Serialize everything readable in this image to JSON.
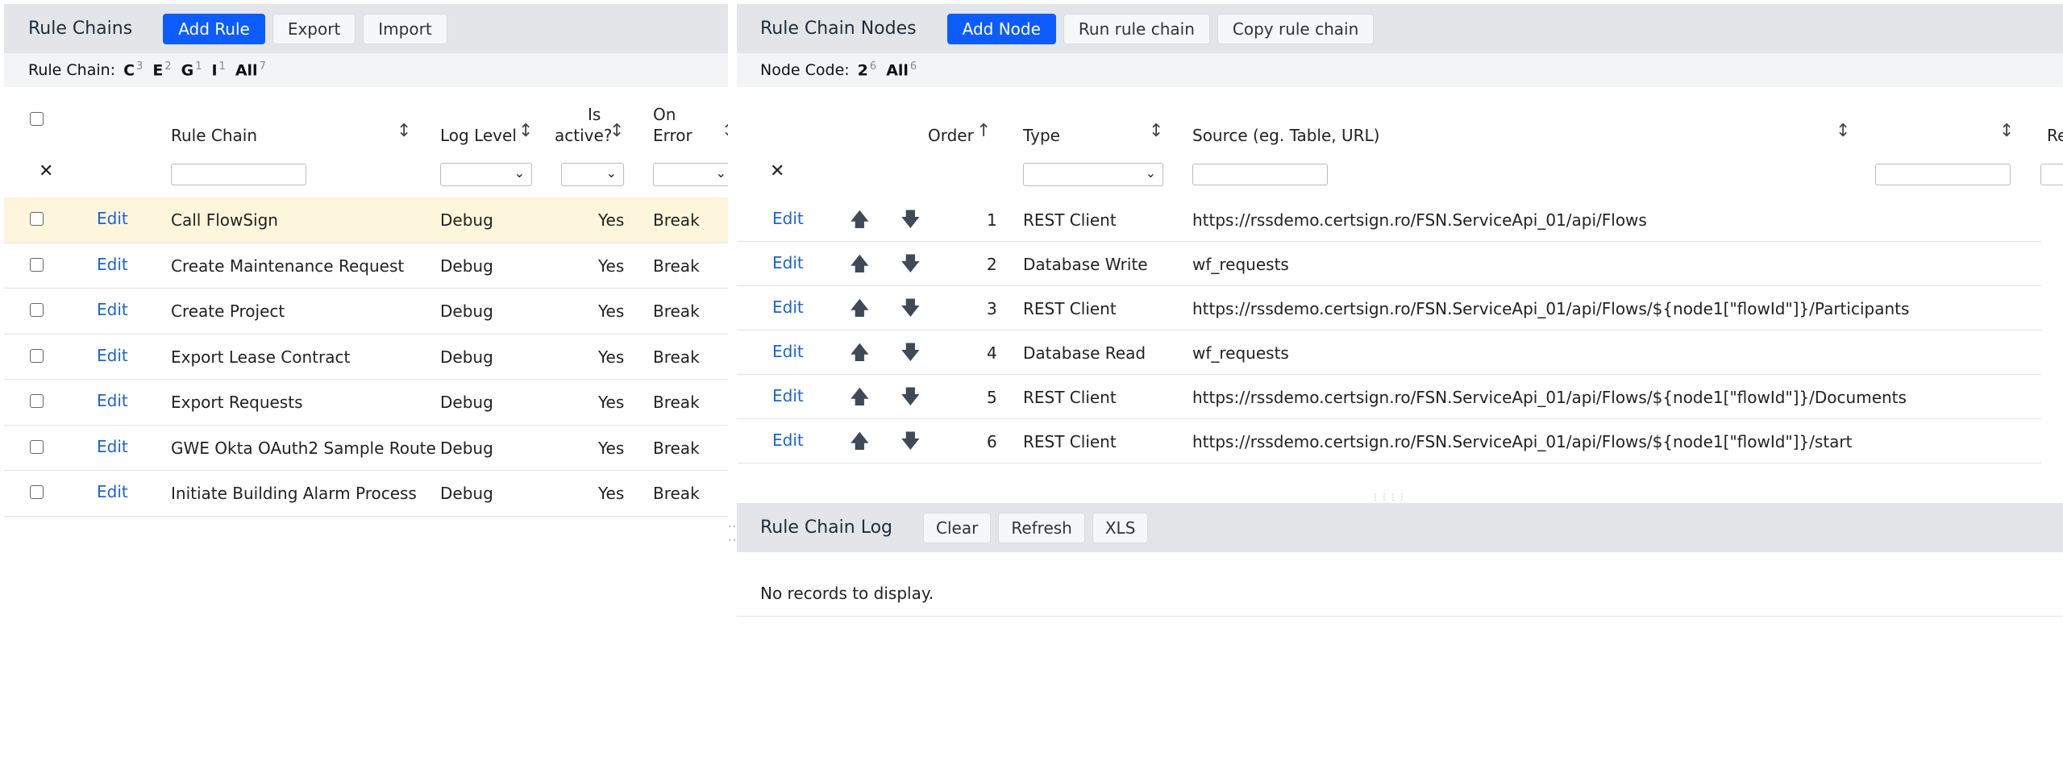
{
  "left": {
    "title": "Rule Chains",
    "buttons": {
      "add": "Add Rule",
      "export": "Export",
      "import": "Import"
    },
    "filter": {
      "label": "Rule Chain:",
      "chips": [
        {
          "letter": "C",
          "count": "3"
        },
        {
          "letter": "E",
          "count": "2"
        },
        {
          "letter": "G",
          "count": "1"
        },
        {
          "letter": "I",
          "count": "1"
        },
        {
          "letter": "All",
          "count": "7"
        }
      ]
    },
    "columns": {
      "rule_chain": "Rule Chain",
      "log_level": "Log Level",
      "is_active_1": "Is",
      "is_active_2": "active?",
      "on_error_1": "On",
      "on_error_2": "Error"
    },
    "rows": [
      {
        "edit": "Edit",
        "name": "Call FlowSign",
        "level": "Debug",
        "active": "Yes",
        "error": "Break"
      },
      {
        "edit": "Edit",
        "name": "Create Maintenance Request",
        "level": "Debug",
        "active": "Yes",
        "error": "Break"
      },
      {
        "edit": "Edit",
        "name": "Create Project",
        "level": "Debug",
        "active": "Yes",
        "error": "Break"
      },
      {
        "edit": "Edit",
        "name": "Export Lease Contract",
        "level": "Debug",
        "active": "Yes",
        "error": "Break"
      },
      {
        "edit": "Edit",
        "name": "Export Requests",
        "level": "Debug",
        "active": "Yes",
        "error": "Break"
      },
      {
        "edit": "Edit",
        "name": "GWE Okta OAuth2 Sample Route",
        "level": "Debug",
        "active": "Yes",
        "error": "Break"
      },
      {
        "edit": "Edit",
        "name": "Initiate Building Alarm Process",
        "level": "Debug",
        "active": "Yes",
        "error": "Break"
      }
    ],
    "highlight_color": "#fdf6dc"
  },
  "right": {
    "title": "Rule Chain Nodes",
    "buttons": {
      "add": "Add Node",
      "run": "Run rule chain",
      "copy": "Copy rule chain"
    },
    "filter": {
      "label": "Node Code:",
      "chips": [
        {
          "letter": "2",
          "count": "6"
        },
        {
          "letter": "All",
          "count": "6"
        }
      ]
    },
    "columns": {
      "order": "Order",
      "type": "Type",
      "source": "Source (eg. Table, URL)",
      "extra": "Re"
    },
    "rows": [
      {
        "edit": "Edit",
        "order": "1",
        "type": "REST Client",
        "source": "https://rssdemo.certsign.ro/FSN.ServiceApi_01/api/Flows"
      },
      {
        "edit": "Edit",
        "order": "2",
        "type": "Database Write",
        "source": "wf_requests"
      },
      {
        "edit": "Edit",
        "order": "3",
        "type": "REST Client",
        "source": "https://rssdemo.certsign.ro/FSN.ServiceApi_01/api/Flows/${node1[\"flowId\"]}/Participants"
      },
      {
        "edit": "Edit",
        "order": "4",
        "type": "Database Read",
        "source": "wf_requests"
      },
      {
        "edit": "Edit",
        "order": "5",
        "type": "REST Client",
        "source": "https://rssdemo.certsign.ro/FSN.ServiceApi_01/api/Flows/${node1[\"flowId\"]}/Documents"
      },
      {
        "edit": "Edit",
        "order": "6",
        "type": "REST Client",
        "source": "https://rssdemo.certsign.ro/FSN.ServiceApi_01/api/Flows/${node1[\"flowId\"]}/start"
      }
    ]
  },
  "log": {
    "title": "Rule Chain Log",
    "buttons": {
      "clear": "Clear",
      "refresh": "Refresh",
      "xls": "XLS"
    },
    "empty": "No records to display."
  },
  "colors": {
    "primary": "#0d5cff",
    "link": "#1a63d8",
    "toolbar": "#e3e5e8"
  }
}
